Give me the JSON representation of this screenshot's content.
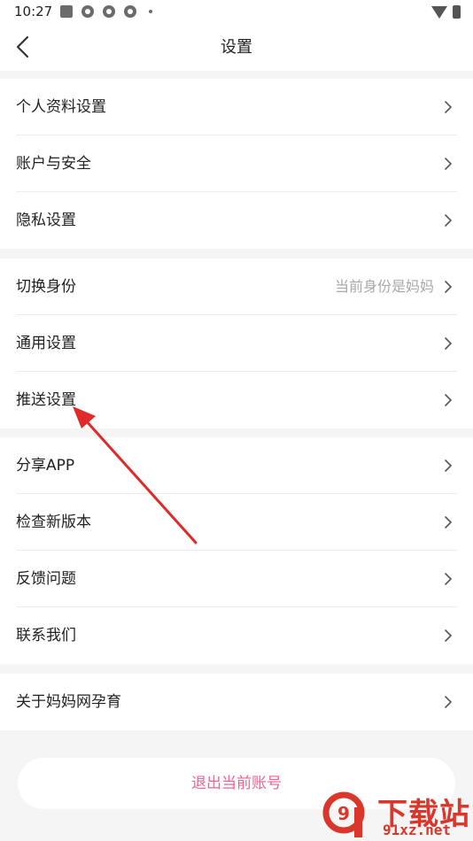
{
  "status_bar": {
    "time": "10:27"
  },
  "header": {
    "title": "设置"
  },
  "groups": [
    {
      "items": [
        {
          "label": "个人资料设置"
        },
        {
          "label": "账户与安全"
        },
        {
          "label": "隐私设置"
        }
      ]
    },
    {
      "items": [
        {
          "label": "切换身份",
          "value": "当前身份是妈妈"
        },
        {
          "label": "通用设置"
        },
        {
          "label": "推送设置"
        }
      ]
    },
    {
      "items": [
        {
          "label": "分享APP"
        },
        {
          "label": "检查新版本"
        },
        {
          "label": "反馈问题"
        },
        {
          "label": "联系我们"
        }
      ]
    },
    {
      "items": [
        {
          "label": "关于妈妈网孕育"
        }
      ]
    }
  ],
  "logout_label": "退出当前账号",
  "watermark": {
    "logo_text": "9",
    "title": "下载站",
    "domain": "91xz.net"
  },
  "colors": {
    "accent": "#f06292",
    "annotation_arrow": "#e02a2a",
    "watermark": "#d9372b"
  }
}
